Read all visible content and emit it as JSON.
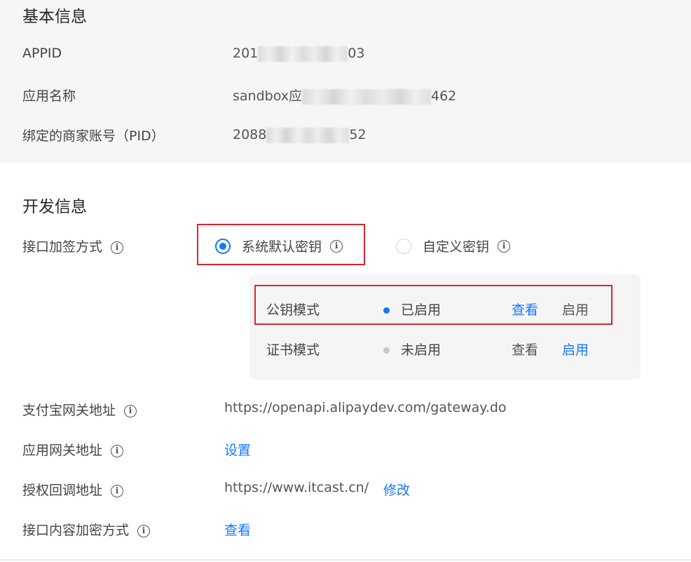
{
  "basic": {
    "title": "基本信息",
    "appid_label": "APPID",
    "appid_prefix": "201",
    "appid_suffix": "03",
    "appname_label": "应用名称",
    "appname_prefix": "sandbox应",
    "appname_suffix": "462",
    "pid_label": "绑定的商家账号（PID）",
    "pid_prefix": "2088",
    "pid_suffix": "52"
  },
  "dev": {
    "title": "开发信息",
    "sign_label": "接口加签方式",
    "option_default": "系统默认密钥",
    "option_custom": "自定义密钥",
    "rows": [
      {
        "mode": "公钥模式",
        "status": "已启用",
        "status_color": "#1677ff",
        "view": "查看",
        "enable": "启用"
      },
      {
        "mode": "证书模式",
        "status": "未启用",
        "status_color": "#c8c8c8",
        "view": "查看",
        "enable": "启用"
      }
    ],
    "gateway_label": "支付宝网关地址",
    "gateway_value": "https://openapi.alipaydev.com/gateway.do",
    "app_gateway_label": "应用网关地址",
    "app_gateway_action": "设置",
    "callback_label": "授权回调地址",
    "callback_value": "https://www.itcast.cn/",
    "callback_action": "修改",
    "encrypt_label": "接口内容加密方式",
    "encrypt_action": "查看"
  },
  "icons": {
    "info": "info-circle-icon",
    "radio_selected": "radio-selected-icon",
    "radio_unselected": "radio-unselected-icon",
    "status_dot": "status-dot-icon"
  },
  "colors": {
    "accent": "#1677ff",
    "highlight_border": "#d9252f",
    "section_bg": "#f6f6f6",
    "panel_bg": "#f5f5f5"
  }
}
